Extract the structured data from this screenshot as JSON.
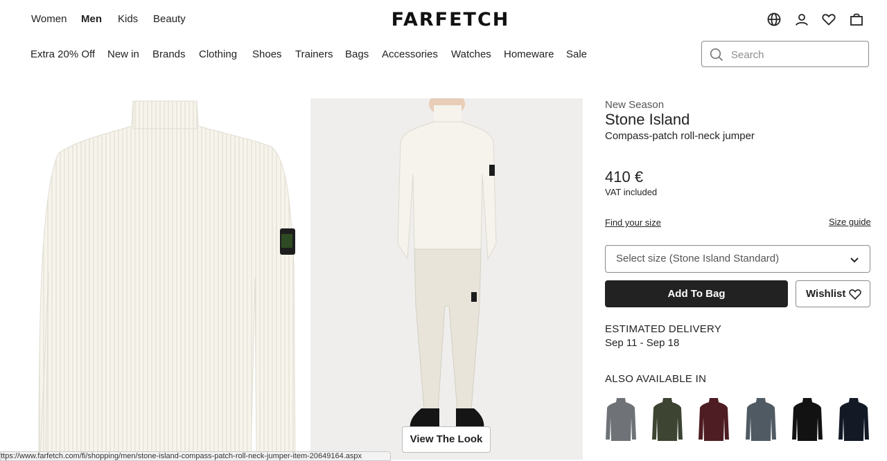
{
  "header": {
    "gender_tabs": [
      "Women",
      "Men",
      "Kids",
      "Beauty"
    ],
    "active_gender": "Men",
    "logo": "FARFETCH",
    "icons": [
      "globe-icon",
      "account-icon",
      "wishlist-heart-icon",
      "bag-icon"
    ]
  },
  "categories": [
    "Extra 20% Off",
    "New in",
    "Brands",
    "Clothing",
    "Shoes",
    "Trainers",
    "Bags",
    "Accessories",
    "Watches",
    "Homeware",
    "Sale"
  ],
  "search": {
    "placeholder": "Search"
  },
  "gallery": {
    "view_look_label": "View The Look"
  },
  "product": {
    "season": "New Season",
    "brand": "Stone Island",
    "name": "Compass-patch roll-neck jumper",
    "price": "410 €",
    "vat": "VAT included",
    "find_size": "Find your size",
    "size_guide": "Size guide",
    "size_select": "Select size (Stone Island Standard)",
    "add_to_bag": "Add To Bag",
    "wishlist": "Wishlist"
  },
  "delivery": {
    "heading": "ESTIMATED DELIVERY",
    "dates": "Sep 11 - Sep 18"
  },
  "also_available": {
    "heading": "ALSO AVAILABLE IN",
    "colors": [
      "#6f7276",
      "#3d4432",
      "#4e1c23",
      "#4f5a63",
      "#121212",
      "#131a26"
    ]
  },
  "status_url": "https://www.farfetch.com/fi/shopping/men/stone-island-compass-patch-roll-neck-jumper-item-20649164.aspx"
}
